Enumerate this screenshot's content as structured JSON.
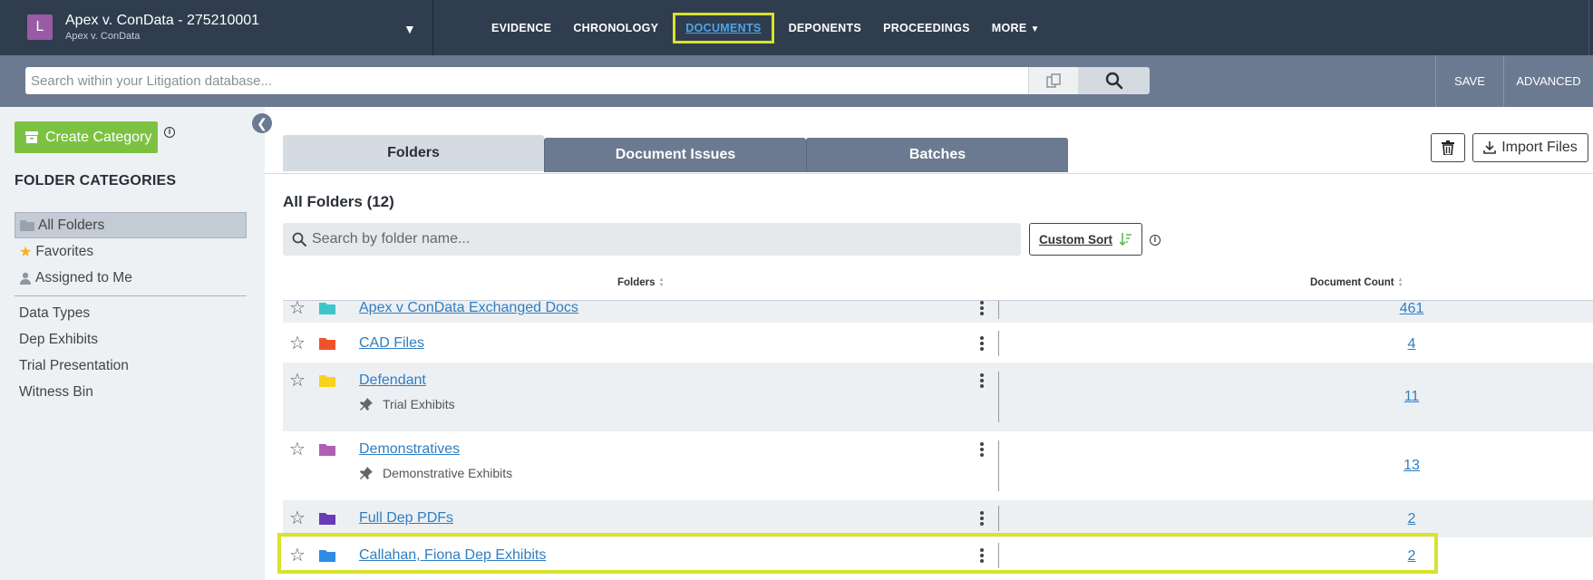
{
  "header": {
    "case_avatar": "L",
    "case_title": "Apex v. ConData - 275210001",
    "case_subtitle": "Apex v. ConData",
    "nav": [
      {
        "label": "EVIDENCE"
      },
      {
        "label": "CHRONOLOGY"
      },
      {
        "label": "DOCUMENTS",
        "active": true
      },
      {
        "label": "DEPONENTS"
      },
      {
        "label": "PROCEEDINGS"
      },
      {
        "label": "MORE"
      }
    ]
  },
  "search": {
    "placeholder": "Search within your Litigation database...",
    "save_label": "SAVE",
    "advanced_label": "ADVANCED"
  },
  "sidebar": {
    "create_label": "Create Category",
    "heading": "FOLDER CATEGORIES",
    "items": [
      {
        "label": "All Folders",
        "icon": "folder-icon",
        "selected": true
      },
      {
        "label": "Favorites",
        "icon": "star-icon"
      },
      {
        "label": "Assigned to Me",
        "icon": "user-icon"
      }
    ],
    "categories": [
      {
        "label": "Data Types"
      },
      {
        "label": "Dep Exhibits"
      },
      {
        "label": "Trial Presentation"
      },
      {
        "label": "Witness Bin"
      }
    ]
  },
  "main": {
    "tabs": [
      {
        "label": "Folders",
        "active": true
      },
      {
        "label": "Document Issues"
      },
      {
        "label": "Batches"
      }
    ],
    "import_label": "Import Files",
    "all_folders_title": "All Folders (12)",
    "folder_search_placeholder": "Search by folder name...",
    "custom_sort_label": "Custom Sort",
    "col_folders": "Folders",
    "col_count": "Document Count",
    "rows": [
      {
        "name": "Apex v ConData Exchanged Docs",
        "count": "461",
        "folder_color": "#3cc6cc"
      },
      {
        "name": "CAD Files",
        "count": "4",
        "folder_color": "#f0522c"
      },
      {
        "name": "Defendant",
        "count": "11",
        "folder_color": "#f7d21e",
        "sub": "Trial Exhibits"
      },
      {
        "name": "Demonstratives",
        "count": "13",
        "folder_color": "#b060b4",
        "sub": "Demonstrative Exhibits"
      },
      {
        "name": "Full Dep PDFs",
        "count": "2",
        "folder_color": "#6a3bb5"
      },
      {
        "name": "Callahan, Fiona Dep Exhibits",
        "count": "2",
        "folder_color": "#2d8de6"
      }
    ]
  },
  "colors": {
    "header_bg": "#2f3d4e",
    "search_bg": "#6b7a90",
    "accent_green": "#7cc242",
    "highlight": "#d9e22d",
    "link": "#2f7ec1"
  }
}
